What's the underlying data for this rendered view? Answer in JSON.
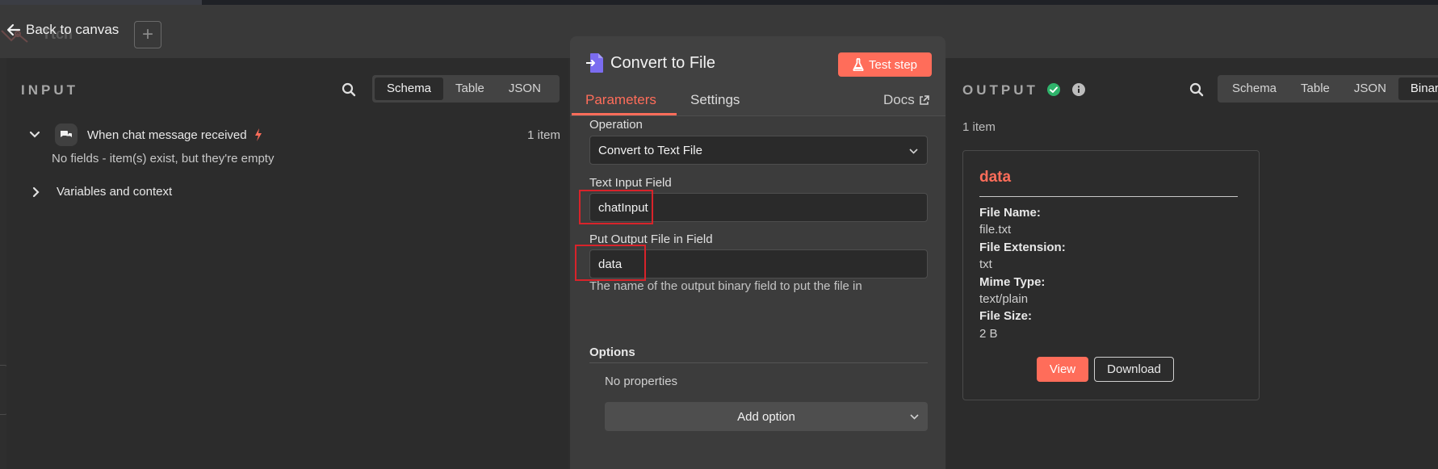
{
  "canvas": {
    "back_label": "Back to canvas",
    "workflow_name_fragment": "Ttch",
    "add_label": "+"
  },
  "input_panel": {
    "title": "INPUT",
    "view_tabs": [
      "Schema",
      "Table",
      "JSON"
    ],
    "active_tab": "Schema",
    "trigger_node": "When chat message received",
    "item_count": "1 item",
    "empty_message": "No fields - item(s) exist, but they're empty",
    "variables_label": "Variables and context"
  },
  "node": {
    "title": "Convert to File",
    "test_button": "Test step",
    "tabs": {
      "parameters": "Parameters",
      "settings": "Settings"
    },
    "docs_label": "Docs",
    "operation_label": "Operation",
    "operation_value": "Convert to Text File",
    "text_input_label": "Text Input Field",
    "text_input_value": "chatInput",
    "output_field_label": "Put Output File in Field",
    "output_field_value": "data",
    "output_field_hint": "The name of the output binary field to put the file in",
    "options_title": "Options",
    "no_properties": "No properties",
    "add_option": "Add option"
  },
  "output_panel": {
    "title": "OUTPUT",
    "view_tabs": [
      "Schema",
      "Table",
      "JSON",
      "Binary"
    ],
    "active_tab": "Binary",
    "item_count": "1 item",
    "binary": {
      "name": "data",
      "file_name_label": "File Name:",
      "file_name": "file.txt",
      "file_ext_label": "File Extension:",
      "file_ext": "txt",
      "mime_label": "Mime Type:",
      "mime": "text/plain",
      "size_label": "File Size:",
      "size": "2 B",
      "view_button": "View",
      "download_button": "Download"
    }
  },
  "colors": {
    "accent": "#ff6d5a",
    "success": "#2fb36b",
    "highlight_box": "#d8232a"
  }
}
